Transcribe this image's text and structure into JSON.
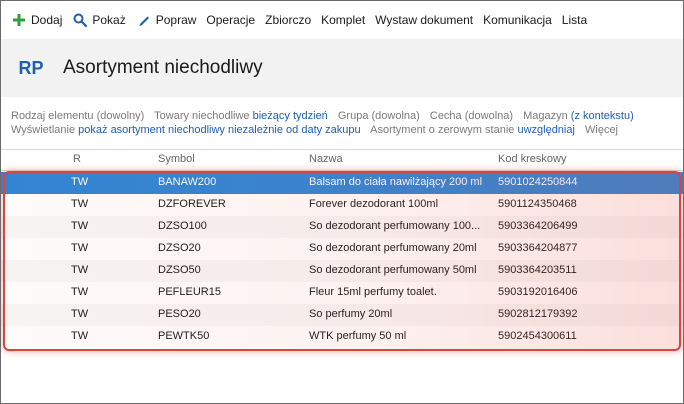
{
  "toolbar": {
    "items": [
      {
        "label": "Dodaj",
        "icon": "plus-icon"
      },
      {
        "label": "Pokaż",
        "icon": "search-icon"
      },
      {
        "label": "Popraw",
        "icon": "pencil-icon"
      },
      {
        "label": "Operacje"
      },
      {
        "label": "Zbiorczo"
      },
      {
        "label": "Komplet"
      },
      {
        "label": "Wystaw dokument"
      },
      {
        "label": "Komunikacja"
      },
      {
        "label": "Lista"
      }
    ]
  },
  "header": {
    "badge": "RP",
    "title": "Asortyment niechodliwy"
  },
  "filters": {
    "row1": [
      {
        "label": "Rodzaj elementu (dowolny)"
      },
      {
        "label": "Towary niechodliwe ",
        "value": "bieżący tydzień"
      },
      {
        "label": "Grupa (dowolna)"
      },
      {
        "label": "Cecha (dowolna)"
      },
      {
        "label": "Magazyn ",
        "value": "(z kontekstu)"
      }
    ],
    "row2": [
      {
        "label": "Wyświetlanie ",
        "value": "pokaż asortyment niechodliwy niezależnie od daty zakupu"
      },
      {
        "label": "Asortyment o zerowym stanie ",
        "value": "uwzględniaj"
      },
      {
        "label": "Więcej"
      }
    ]
  },
  "table": {
    "columns": [
      "R",
      "Symbol",
      "Nazwa",
      "Kod kreskowy"
    ],
    "rows": [
      {
        "r": "TW",
        "symbol": "BANAW200",
        "name": "Balsam do ciała nawilżający 200 ml",
        "code": "5901024250844"
      },
      {
        "r": "TW",
        "symbol": "DZFOREVER",
        "name": "Forever dezodorant 100ml",
        "code": "5901124350468"
      },
      {
        "r": "TW",
        "symbol": "DZSO100",
        "name": "So dezodorant perfumowany 100...",
        "code": "5903364206499"
      },
      {
        "r": "TW",
        "symbol": "DZSO20",
        "name": "So dezodorant perfumowany 20ml",
        "code": "5903364204877"
      },
      {
        "r": "TW",
        "symbol": "DZSO50",
        "name": "So dezodorant perfumowany 50ml",
        "code": "5903364203511"
      },
      {
        "r": "TW",
        "symbol": "PEFLEUR15",
        "name": "Fleur 15ml perfumy toalet.",
        "code": "5903192016406"
      },
      {
        "r": "TW",
        "symbol": "PESO20",
        "name": "So perfumy 20ml",
        "code": "5902812179392"
      },
      {
        "r": "TW",
        "symbol": "PEWTK50",
        "name": "WTK perfumy 50 ml",
        "code": "5902454300611"
      }
    ]
  },
  "colors": {
    "accent": "#1f5fae",
    "selection": "#2f86d6",
    "add_icon": "#2e9e3e",
    "highlight_border": "#d9453f"
  }
}
